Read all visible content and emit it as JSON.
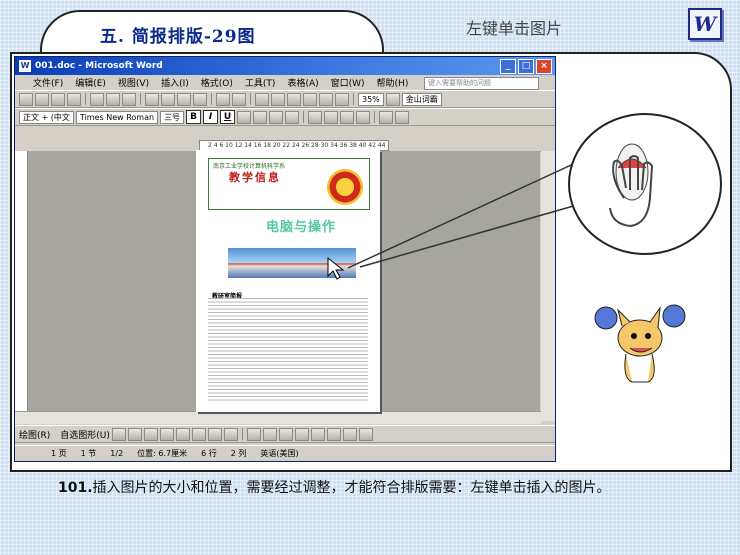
{
  "header": {
    "title": "五. 简报排版-29图",
    "hint": "左键单击图片",
    "logo_letter": "W"
  },
  "word": {
    "window_title": "001.doc - Microsoft Word",
    "menus": [
      "文件(F)",
      "编辑(E)",
      "视图(V)",
      "插入(I)",
      "格式(O)",
      "工具(T)",
      "表格(A)",
      "窗口(W)",
      "帮助(H)"
    ],
    "ask_placeholder": "键入需要帮助的问题",
    "zoom": "35%",
    "toolbar_extra": "金山词霸",
    "style": "正文 + (中文",
    "font": "Times New Roman",
    "size": "三号",
    "ruler_text": "2 4 6 10 12 14 16 18 20 22 24 26 28 30 34 36 38 40 42 44 46",
    "drawing_label": "绘图(R)",
    "autoshape_label": "自选图形(U)",
    "status": {
      "page": "1 页",
      "section": "1 节",
      "pages": "1/2",
      "position": "位置: 6.7厘米",
      "line": "6 行",
      "col": "2 列",
      "lang": "英语(美国)"
    }
  },
  "document": {
    "school": "南京工业学校计算机科学系",
    "newsletter_title": "教学信息",
    "article_title": "电脑与操作",
    "column_head": "教研室简报"
  },
  "caption": {
    "number": "101.",
    "text": "插入图片的大小和位置，需要经过调整，才能符合排版需要：左键单击插入的图片。"
  }
}
